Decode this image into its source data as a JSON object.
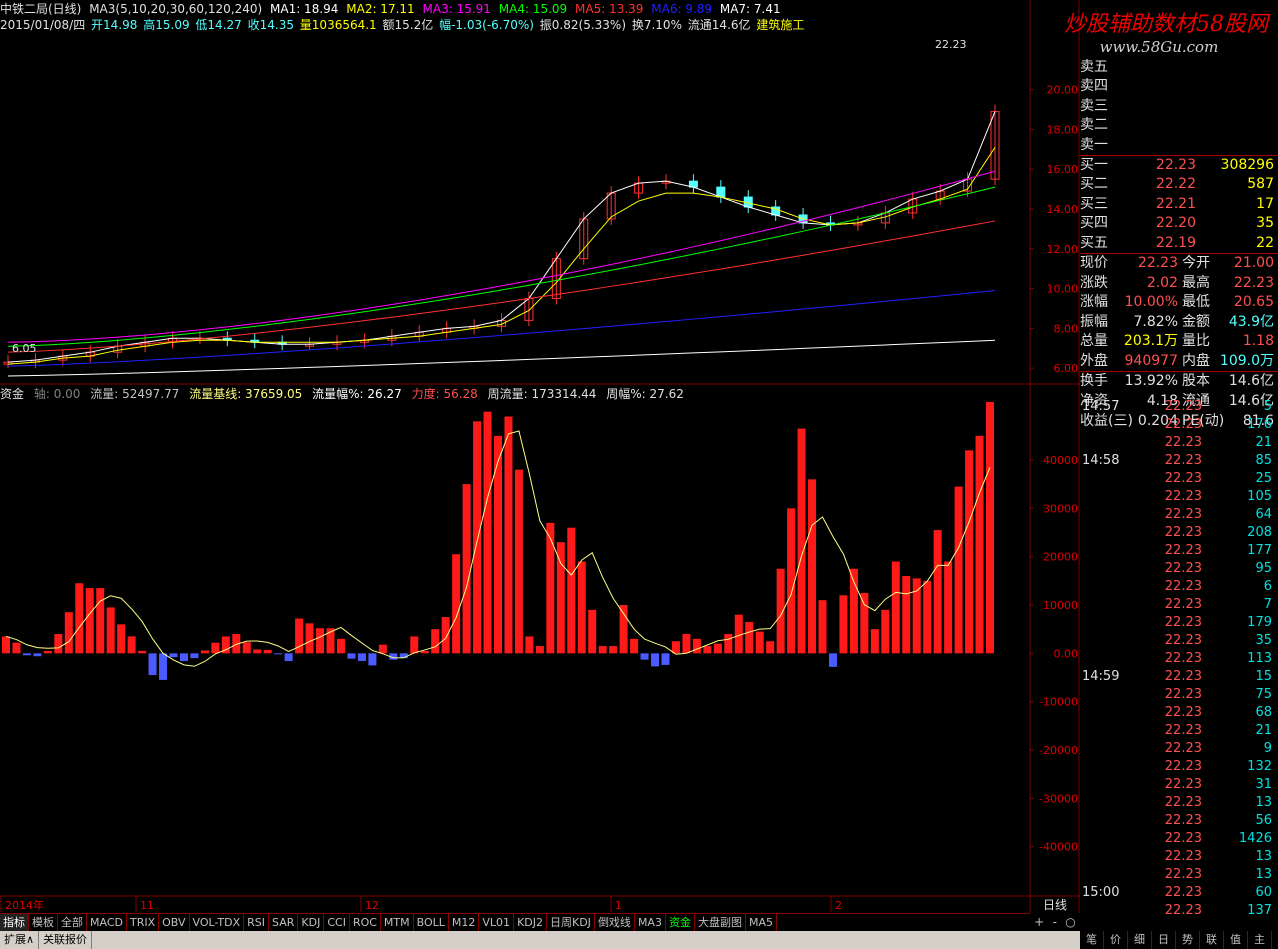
{
  "title": {
    "name": "中铁二局(日线)",
    "ma3": "MA3(5,10,20,30,60,120,240)",
    "ma1": "MA1: 18.94",
    "ma2": "MA2: 17.11",
    "ma3v": "MA3: 15.91",
    "ma4": "MA4: 15.09",
    "ma5": "MA5: 13.39",
    "ma6": "MA6: 9.89",
    "ma7": "MA7: 7.41"
  },
  "info": {
    "date": "2015/01/08/四",
    "open": "开14.98",
    "high": "高15.09",
    "low": "低14.27",
    "close": "收14.35",
    "vol": "量1036564.1",
    "amount": "额15.2亿",
    "change": "幅-1.03(-6.70%)",
    "amp": "振0.82(5.33%)",
    "turnover": "换7.10%",
    "float": "流通14.6亿",
    "sector": "建筑施工"
  },
  "indicator": {
    "name": "资金",
    "axis": "轴: 0.00",
    "flow": "流量: 52497.77",
    "base": "流量基线: 37659.05",
    "pct": "流量幅%: 26.27",
    "power": "力度: 56.28",
    "week": "周流量: 173314.44",
    "weekpct": "周幅%: 27.62"
  },
  "chart_data": [
    {
      "type": "candlestick",
      "title": "中铁二局(日线)",
      "ylim": [
        5.2,
        22.8
      ],
      "yticks": [
        "20.00",
        "18.00",
        "16.00",
        "14.00",
        "12.00",
        "10.00",
        "8.00",
        "6.00"
      ],
      "xlabels": [
        "2014年",
        "11",
        "12",
        "1",
        "2"
      ],
      "annotations": [
        "22.23",
        "6.05"
      ],
      "series": [
        {
          "name": "MA1",
          "values": [
            6.3,
            6.4,
            6.6,
            6.8,
            7.1,
            7.3,
            7.5,
            7.5,
            7.4,
            7.3,
            7.2,
            7.2,
            7.3,
            7.4,
            7.6,
            7.8,
            8.0,
            8.1,
            8.4,
            9.5,
            11.5,
            13.5,
            14.8,
            15.3,
            15.4,
            15.1,
            14.6,
            14.1,
            13.7,
            13.3,
            13.2,
            13.3,
            13.8,
            14.5,
            14.9,
            15.5,
            18.9
          ]
        },
        {
          "name": "MA2",
          "values": [
            6.2,
            6.3,
            6.5,
            6.6,
            6.9,
            7.1,
            7.3,
            7.4,
            7.4,
            7.3,
            7.3,
            7.3,
            7.3,
            7.4,
            7.5,
            7.6,
            7.8,
            8.0,
            8.2,
            8.9,
            10.3,
            12.0,
            13.6,
            14.4,
            14.8,
            14.8,
            14.6,
            14.3,
            14.0,
            13.5,
            13.2,
            13.3,
            13.6,
            14.1,
            14.5,
            15.0,
            17.1
          ]
        }
      ]
    },
    {
      "type": "bar",
      "title": "资金",
      "ylim": [
        -50000,
        52000
      ],
      "yticks": [
        "40000",
        "30000",
        "20000",
        "10000",
        "0.00",
        "-10000",
        "-20000",
        "-30000",
        "-40000"
      ],
      "values": [
        3500,
        2200,
        -400,
        -600,
        500,
        4000,
        8500,
        14500,
        13500,
        13500,
        9500,
        6000,
        3500,
        500,
        -4500,
        -5500,
        -800,
        -1600,
        -1000,
        600,
        2200,
        3500,
        4000,
        2300,
        800,
        700,
        -200,
        -1600,
        7200,
        6200,
        5200,
        5200,
        3000,
        -1100,
        -1600,
        -2500,
        1800,
        -1300,
        -1000,
        3500,
        500,
        5000,
        7500,
        20500,
        35000,
        48000,
        50000,
        45000,
        49000,
        38000,
        3500,
        1500,
        27000,
        23000,
        26000,
        19000,
        9000,
        1500,
        1500,
        10000,
        3000,
        -1300,
        -2700,
        -2400,
        2500,
        4000,
        3000,
        1500,
        2000,
        4000,
        8000,
        6500,
        4500,
        2500,
        17500,
        30000,
        46500,
        36000,
        11000,
        -2800,
        12000,
        17500,
        12500,
        5000,
        9000,
        19000,
        16000,
        15500,
        15000,
        25500,
        19000,
        34500,
        42000,
        45000,
        52000
      ]
    }
  ],
  "quotes": {
    "sells": [
      {
        "label": "卖五",
        "price": "",
        "vol": ""
      },
      {
        "label": "卖四",
        "price": "",
        "vol": ""
      },
      {
        "label": "卖三",
        "price": "",
        "vol": ""
      },
      {
        "label": "卖二",
        "price": "",
        "vol": ""
      },
      {
        "label": "卖一",
        "price": "",
        "vol": ""
      }
    ],
    "buys": [
      {
        "label": "买一",
        "price": "22.23",
        "vol": "308296"
      },
      {
        "label": "买二",
        "price": "22.22",
        "vol": "587"
      },
      {
        "label": "买三",
        "price": "22.21",
        "vol": "17"
      },
      {
        "label": "买四",
        "price": "22.20",
        "vol": "35"
      },
      {
        "label": "买五",
        "price": "22.19",
        "vol": "22"
      }
    ],
    "stats": [
      {
        "l1": "现价",
        "v1": "22.23",
        "l2": "今开",
        "v2": "21.00"
      },
      {
        "l1": "涨跌",
        "v1": "2.02",
        "l2": "最高",
        "v2": "22.23"
      },
      {
        "l1": "涨幅",
        "v1": "10.00%",
        "l2": "最低",
        "v2": "20.65"
      },
      {
        "l1": "振幅",
        "v1": "7.82%",
        "l2": "金额",
        "v2": "43.9亿"
      },
      {
        "l1": "总量",
        "v1": "203.1万",
        "l2": "量比",
        "v2": "1.18"
      },
      {
        "l1": "外盘",
        "v1": "940977",
        "l2": "内盘",
        "v2": "109.0万"
      }
    ],
    "fund": [
      {
        "l1": "换手",
        "v1": "13.92%",
        "l2": "股本",
        "v2": "14.6亿"
      },
      {
        "l1": "净资",
        "v1": "4.18",
        "l2": "流通",
        "v2": "14.6亿"
      },
      {
        "l1": "收益(三)",
        "v1": "0.204",
        "l2": "PE(动)",
        "v2": "81.6"
      }
    ]
  },
  "ticks": [
    {
      "time": "14:57",
      "price": "22.23",
      "vol": "5"
    },
    {
      "time": "",
      "price": "22.23",
      "vol": "176"
    },
    {
      "time": "",
      "price": "22.23",
      "vol": "21"
    },
    {
      "time": "14:58",
      "price": "22.23",
      "vol": "85"
    },
    {
      "time": "",
      "price": "22.23",
      "vol": "25"
    },
    {
      "time": "",
      "price": "22.23",
      "vol": "105"
    },
    {
      "time": "",
      "price": "22.23",
      "vol": "64"
    },
    {
      "time": "",
      "price": "22.23",
      "vol": "208"
    },
    {
      "time": "",
      "price": "22.23",
      "vol": "177"
    },
    {
      "time": "",
      "price": "22.23",
      "vol": "95"
    },
    {
      "time": "",
      "price": "22.23",
      "vol": "6"
    },
    {
      "time": "",
      "price": "22.23",
      "vol": "7"
    },
    {
      "time": "",
      "price": "22.23",
      "vol": "179"
    },
    {
      "time": "",
      "price": "22.23",
      "vol": "35"
    },
    {
      "time": "",
      "price": "22.23",
      "vol": "113"
    },
    {
      "time": "14:59",
      "price": "22.23",
      "vol": "15"
    },
    {
      "time": "",
      "price": "22.23",
      "vol": "75"
    },
    {
      "time": "",
      "price": "22.23",
      "vol": "68"
    },
    {
      "time": "",
      "price": "22.23",
      "vol": "21"
    },
    {
      "time": "",
      "price": "22.23",
      "vol": "9"
    },
    {
      "time": "",
      "price": "22.23",
      "vol": "132"
    },
    {
      "time": "",
      "price": "22.23",
      "vol": "31"
    },
    {
      "time": "",
      "price": "22.23",
      "vol": "13"
    },
    {
      "time": "",
      "price": "22.23",
      "vol": "56"
    },
    {
      "time": "",
      "price": "22.23",
      "vol": "1426"
    },
    {
      "time": "",
      "price": "22.23",
      "vol": "13"
    },
    {
      "time": "",
      "price": "22.23",
      "vol": "13"
    },
    {
      "time": "15:00",
      "price": "22.23",
      "vol": "60"
    },
    {
      "time": "",
      "price": "22.23",
      "vol": "137"
    }
  ],
  "tabs": [
    "指标",
    "模板",
    "全部",
    "MACD",
    "TRIX",
    "OBV",
    "VOL-TDX",
    "RSI",
    "SAR",
    "KDJ",
    "CCI",
    "ROC",
    "MTM",
    "BOLL",
    "M12",
    "VL01",
    "KDJ2",
    "日周KDJ",
    "倒戏线",
    "MA3",
    "资金",
    "大盘副图",
    "MA5"
  ],
  "status": [
    "扩展∧",
    "关联报价"
  ],
  "right_status": [
    "笔",
    "价",
    "细",
    "日",
    "势",
    "联",
    "值",
    "主",
    "筹"
  ],
  "period": "日线",
  "watermark": "炒股辅助数材58股网",
  "watermark_url": "www.58Gu.com",
  "colors": {
    "up": "#ff3232",
    "down": "#54ffff",
    "bg": "#000000",
    "grid": "#800000"
  }
}
